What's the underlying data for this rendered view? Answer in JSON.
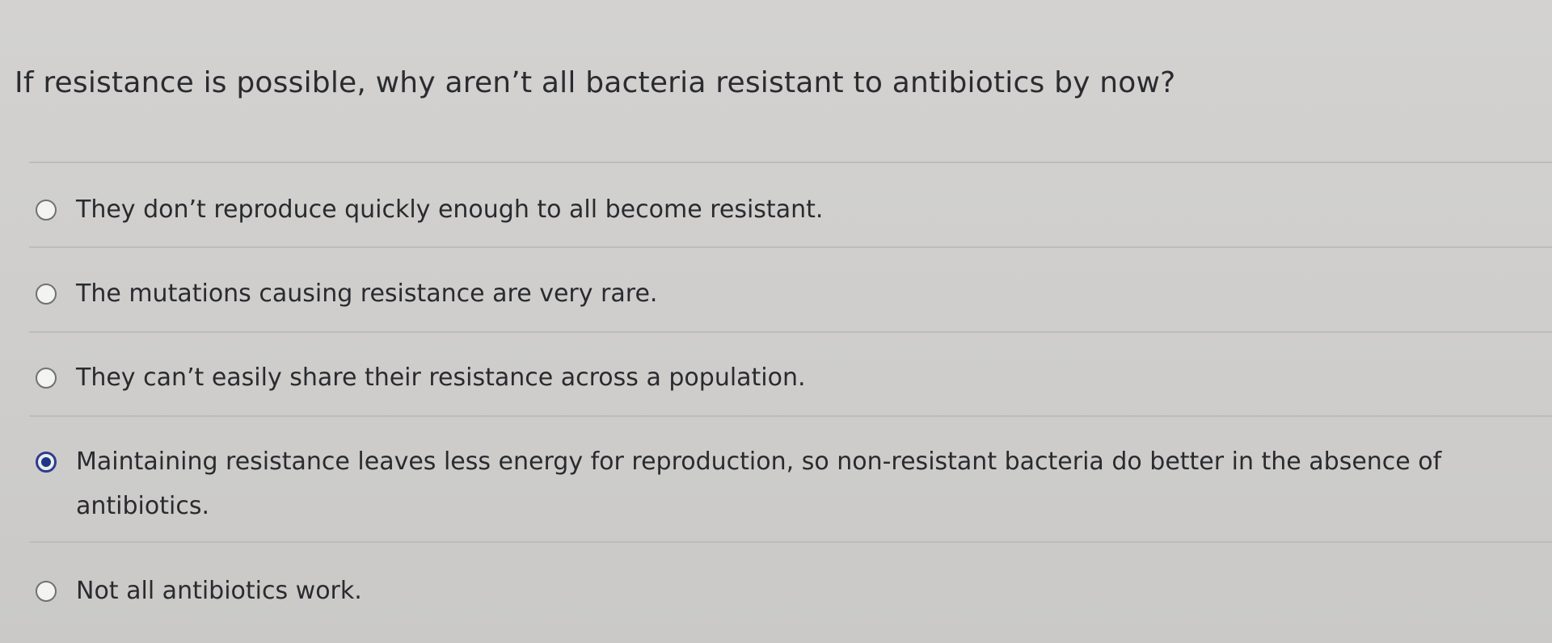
{
  "question": {
    "text": "If resistance is possible, why aren’t all bacteria resistant to antibiotics by now?"
  },
  "options": [
    {
      "label": "They don’t reproduce quickly enough to all become resistant.",
      "selected": false
    },
    {
      "label": "The mutations causing resistance are very rare.",
      "selected": false
    },
    {
      "label": "They can’t easily share their resistance across a population.",
      "selected": false
    },
    {
      "label": "Maintaining resistance leaves less energy for reproduction, so non-resistant bacteria do better in the absence of antibiotics.",
      "selected": true
    },
    {
      "label": "Not all antibiotics work.",
      "selected": false
    }
  ],
  "colors": {
    "background": "#d0cfcd",
    "text": "#2a2b2f",
    "radio_selected": "#1f3585",
    "divider": "#bdbcba"
  }
}
